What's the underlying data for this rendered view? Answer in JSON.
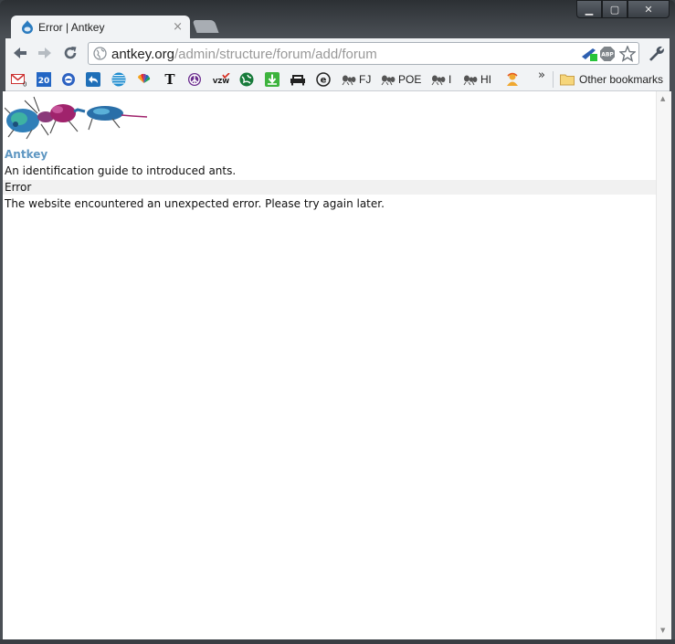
{
  "window": {
    "controls": {
      "minimize": "▁",
      "maximize": "▢",
      "close": "✕"
    }
  },
  "tab": {
    "title": "Error | Antkey",
    "close": "×"
  },
  "toolbar": {
    "url_host": "antkey.org",
    "url_path": "/admin/structure/forum/add/forum",
    "abp_label": "ABP"
  },
  "bookmarks": {
    "items": [
      {
        "icon": "gmail-icon",
        "label": ""
      },
      {
        "icon": "calendar-icon",
        "label": ""
      },
      {
        "icon": "weather-icon",
        "label": ""
      },
      {
        "icon": "reply-icon",
        "label": ""
      },
      {
        "icon": "att-icon",
        "label": ""
      },
      {
        "icon": "nbc-icon",
        "label": ""
      },
      {
        "icon": "nyt-icon",
        "label": ""
      },
      {
        "icon": "peace-icon",
        "label": ""
      },
      {
        "icon": "vzw-icon",
        "label": ""
      },
      {
        "icon": "globe-green-icon",
        "label": ""
      },
      {
        "icon": "download-icon",
        "label": ""
      },
      {
        "icon": "couch-icon",
        "label": ""
      },
      {
        "icon": "e-icon",
        "label": ""
      },
      {
        "icon": "ant-icon",
        "label": "FJ"
      },
      {
        "icon": "ant-icon",
        "label": "POE"
      },
      {
        "icon": "ant-icon",
        "label": "I"
      },
      {
        "icon": "ant-icon",
        "label": "HI"
      },
      {
        "icon": "person-icon",
        "label": ""
      }
    ],
    "more": "»",
    "other": "Other bookmarks"
  },
  "page": {
    "site_name": "Antkey",
    "slogan": "An identification guide to introduced ants.",
    "error_title": "Error",
    "error_message": "The website encountered an unexpected error. Please try again later."
  }
}
